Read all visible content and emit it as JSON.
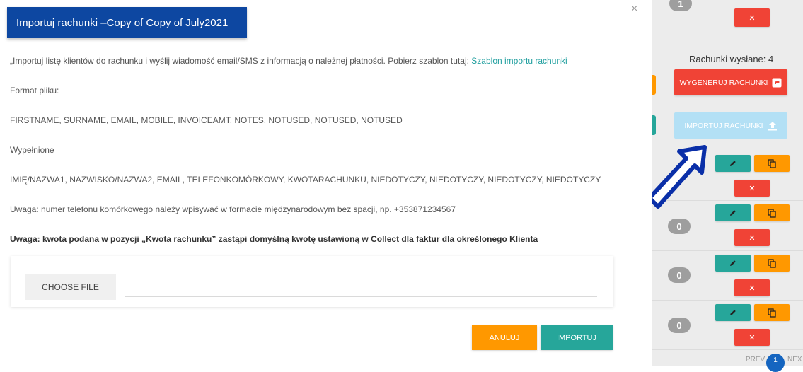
{
  "dialog": {
    "title": "Importuj rachunki –Copy of Copy of July2021",
    "close_symbol": "×",
    "intro_text": "„Importuj listę klientów do rachunku i wyślij wiadomość email/SMS z informacją o należnej płatności. Pobierz szablon tutaj:",
    "template_link": "Szablon importu rachunki",
    "format_label": "Format pliku:",
    "format_columns": "FIRSTNAME, SURNAME, EMAIL, MOBILE, INVOICEAMT, NOTES, NOTUSED, NOTUSED, NOTUSED",
    "filled_label": "Wypełnione",
    "filled_columns": "IMIĘ/NAZWA1, NAZWISKO/NAZWA2, EMAIL, TELEFONKOMÓRKOWY, KWOTARACHUNKU, NIEDOTYCZY, NIEDOTYCZY, NIEDOTYCZY, NIEDOTYCZY",
    "phone_note": "Uwaga: numer telefonu komórkowego należy wpisywać w formacie międzynarodowym bez spacji, np. +353871234567",
    "amount_note": "Uwaga: kwota podana w pozycji „Kwota rachunku” zastąpi domyślną kwotę ustawioną w Collect dla faktur dla określonego Klienta",
    "choose_file_label": "CHOOSE FILE",
    "cancel_label": "ANULUJ",
    "import_label": "IMPORTUJ"
  },
  "background": {
    "sent_text": "Rachunki wysłane: 4",
    "generate_label": "WYGENERUJ RACHUNKI",
    "import_invoices_label": "IMPORTUJ RACHUNKI",
    "badges": [
      "1",
      "0",
      "0",
      "0"
    ],
    "delete_symbol": "✕",
    "pager_prev": "PREV",
    "pager_page": "1",
    "pager_next": "NEX"
  },
  "colors": {
    "header_blue": "#0d47a1",
    "red": "#f04336",
    "orange": "#ff9800",
    "teal": "#26a69a",
    "light_blue": "#b3e0f5",
    "annotation_arrow": "#0a2fa8"
  },
  "icons": {
    "edit": "pencil-icon",
    "copy": "copy-icon",
    "delete": "close-icon",
    "generate": "share-icon",
    "import": "upload-icon",
    "annotation": "arrow-icon"
  }
}
